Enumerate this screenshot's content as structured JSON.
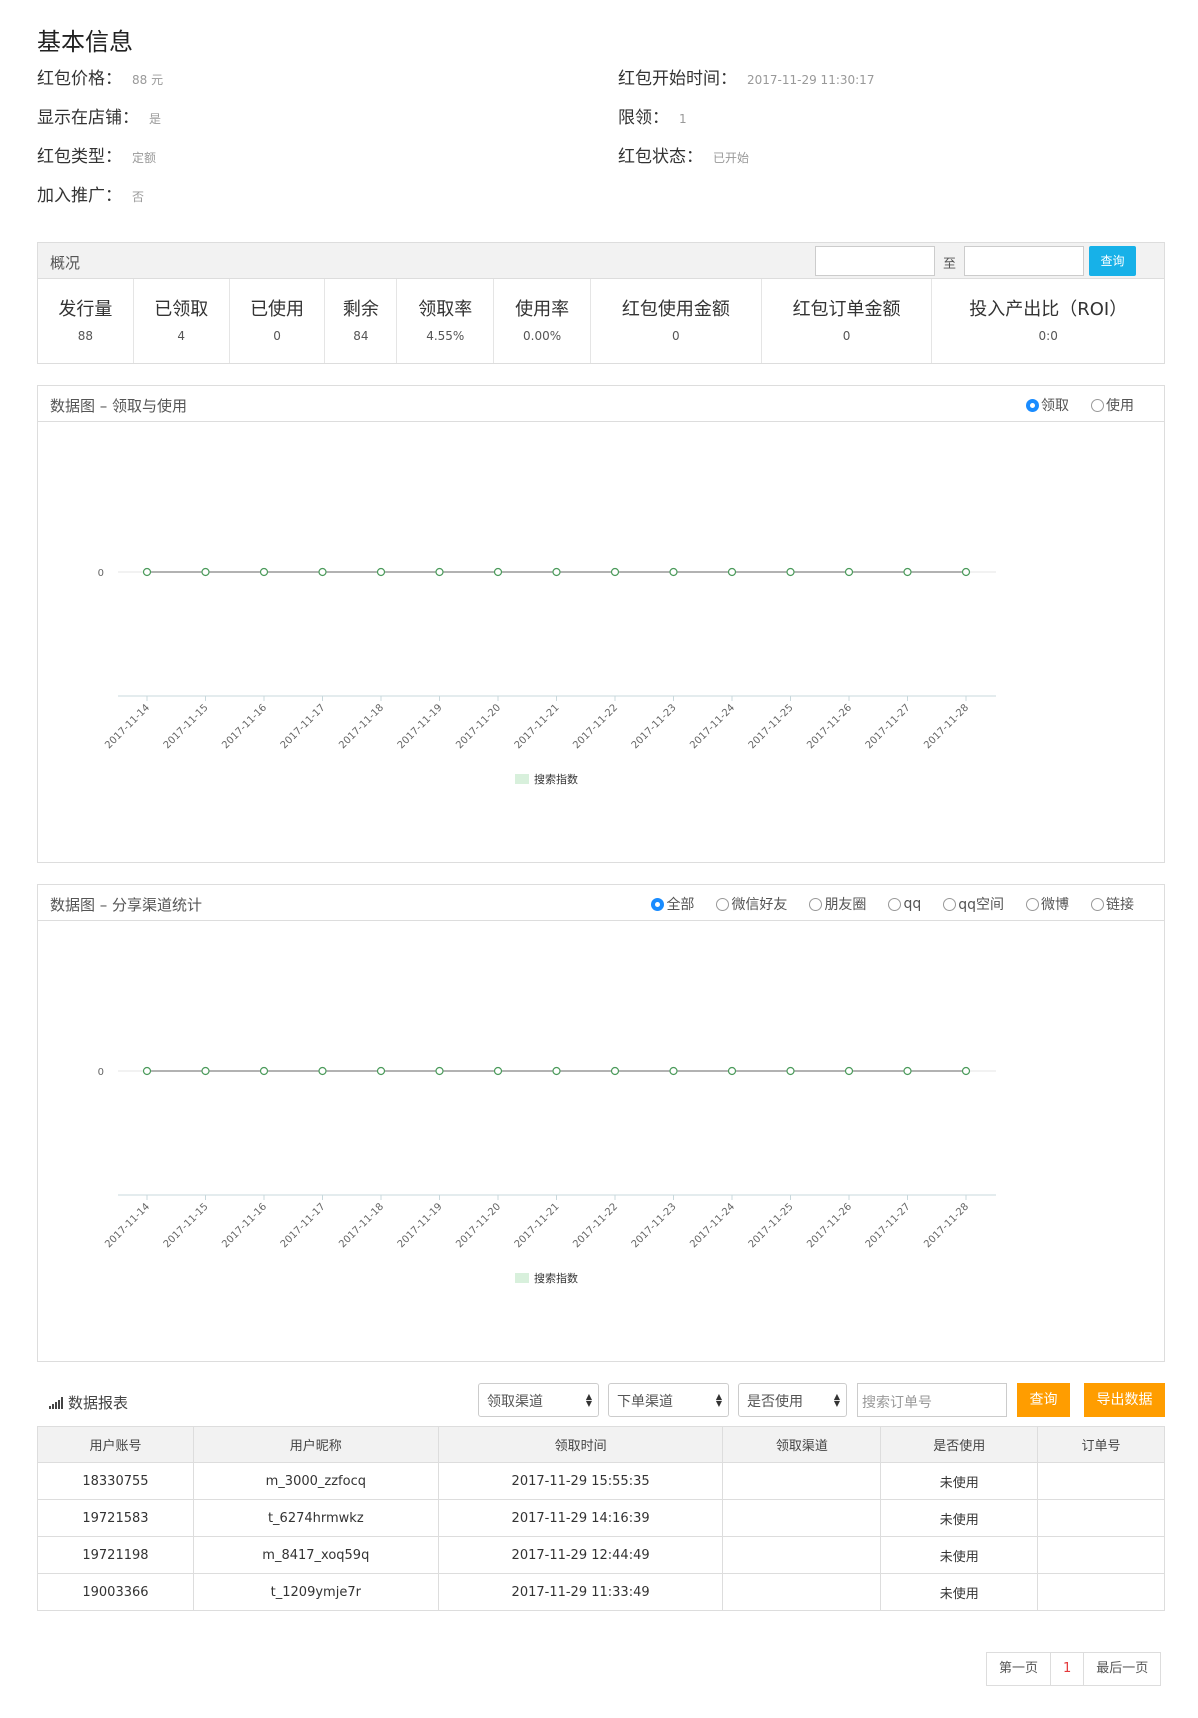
{
  "basic": {
    "title": "基本信息",
    "price_label": "红包价格：",
    "price_value": "88 元",
    "start_label": "红包开始时间：",
    "start_value": "2017-11-29 11:30:17",
    "shop_label": "显示在店铺：",
    "shop_value": "是",
    "limit_label": "限领：",
    "limit_value": "1",
    "type_label": "红包类型：",
    "type_value": "定额",
    "status_label": "红包状态：",
    "status_value": "已开始",
    "promo_label": "加入推广：",
    "promo_value": "否"
  },
  "overview": {
    "title": "概况",
    "to_label": "至",
    "query_button": "查询",
    "stats": [
      {
        "label": "发行量",
        "value": "88"
      },
      {
        "label": "已领取",
        "value": "4"
      },
      {
        "label": "已使用",
        "value": "0"
      },
      {
        "label": "剩余",
        "value": "84"
      },
      {
        "label": "领取率",
        "value": "4.55%"
      },
      {
        "label": "使用率",
        "value": "0.00%"
      },
      {
        "label": "红包使用金额",
        "value": "0"
      },
      {
        "label": "红包订单金额",
        "value": "0"
      },
      {
        "label": "投入产出比（ROI）",
        "value": "0:0"
      }
    ]
  },
  "chart1": {
    "title": "数据图 – 领取与使用",
    "radios": [
      {
        "label": "领取",
        "checked": true
      },
      {
        "label": "使用",
        "checked": false
      }
    ]
  },
  "chart2": {
    "title": "数据图 – 分享渠道统计",
    "radios": [
      {
        "label": "全部",
        "checked": true
      },
      {
        "label": "微信好友",
        "checked": false
      },
      {
        "label": "朋友圈",
        "checked": false
      },
      {
        "label": "qq",
        "checked": false
      },
      {
        "label": "qq空间",
        "checked": false
      },
      {
        "label": "微博",
        "checked": false
      },
      {
        "label": "链接",
        "checked": false
      }
    ]
  },
  "chart_data": [
    {
      "type": "line",
      "categories": [
        "2017-11-14",
        "2017-11-15",
        "2017-11-16",
        "2017-11-17",
        "2017-11-18",
        "2017-11-19",
        "2017-11-20",
        "2017-11-21",
        "2017-11-22",
        "2017-11-23",
        "2017-11-24",
        "2017-11-25",
        "2017-11-26",
        "2017-11-27",
        "2017-11-28"
      ],
      "series": [
        {
          "name": "搜索指数",
          "values": [
            0,
            0,
            0,
            0,
            0,
            0,
            0,
            0,
            0,
            0,
            0,
            0,
            0,
            0,
            0
          ]
        }
      ],
      "ytick": "0",
      "legend_position": "bottom",
      "colors": {
        "line": "#666666",
        "marker": "#4a9a5a",
        "legend": "#d8f0dc",
        "axis": "#c8d8dc"
      }
    },
    {
      "type": "line",
      "categories": [
        "2017-11-14",
        "2017-11-15",
        "2017-11-16",
        "2017-11-17",
        "2017-11-18",
        "2017-11-19",
        "2017-11-20",
        "2017-11-21",
        "2017-11-22",
        "2017-11-23",
        "2017-11-24",
        "2017-11-25",
        "2017-11-26",
        "2017-11-27",
        "2017-11-28"
      ],
      "series": [
        {
          "name": "搜索指数",
          "values": [
            0,
            0,
            0,
            0,
            0,
            0,
            0,
            0,
            0,
            0,
            0,
            0,
            0,
            0,
            0
          ]
        }
      ],
      "ytick": "0",
      "legend_position": "bottom",
      "colors": {
        "line": "#666666",
        "marker": "#4a9a5a",
        "legend": "#d8f0dc",
        "axis": "#c8d8dc"
      }
    }
  ],
  "report": {
    "title": "数据报表",
    "filters": {
      "channel": "领取渠道",
      "order_channel": "下单渠道",
      "used": "是否使用",
      "search_placeholder": "搜索订单号"
    },
    "query_button": "查询",
    "export_button": "导出数据",
    "columns": [
      "用户账号",
      "用户昵称",
      "领取时间",
      "领取渠道",
      "是否使用",
      "订单号"
    ],
    "rows": [
      [
        "18330755",
        "m_3000_zzfocq",
        "2017-11-29 15:55:35",
        "",
        "未使用",
        ""
      ],
      [
        "19721583",
        "t_6274hrmwkz",
        "2017-11-29 14:16:39",
        "",
        "未使用",
        ""
      ],
      [
        "19721198",
        "m_8417_xoq59q",
        "2017-11-29 12:44:49",
        "",
        "未使用",
        ""
      ],
      [
        "19003366",
        "t_1209ymje7r",
        "2017-11-29 11:33:49",
        "",
        "未使用",
        ""
      ]
    ]
  },
  "pager": {
    "first": "第一页",
    "current": "1",
    "last": "最后一页"
  }
}
